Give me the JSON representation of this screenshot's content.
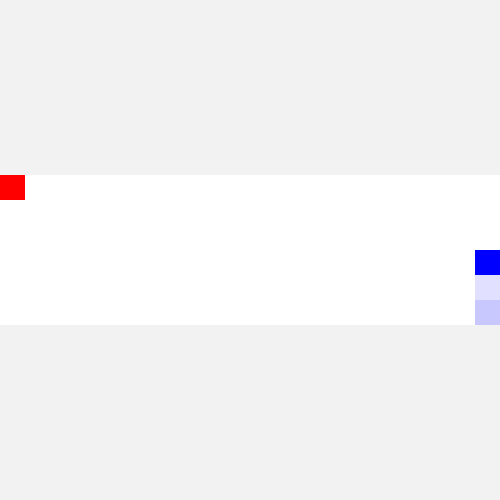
{
  "panel": {
    "background_color": "#ffffff"
  },
  "page": {
    "background_color": "#f2f2f2"
  },
  "blocks": [
    {
      "name": "red-square",
      "color": "#ff0000"
    },
    {
      "name": "blue-square",
      "color": "#0000ff"
    },
    {
      "name": "light-blue-square",
      "color": "#e1e1ff"
    },
    {
      "name": "pale-blue-square",
      "color": "#c8c8ff"
    }
  ]
}
